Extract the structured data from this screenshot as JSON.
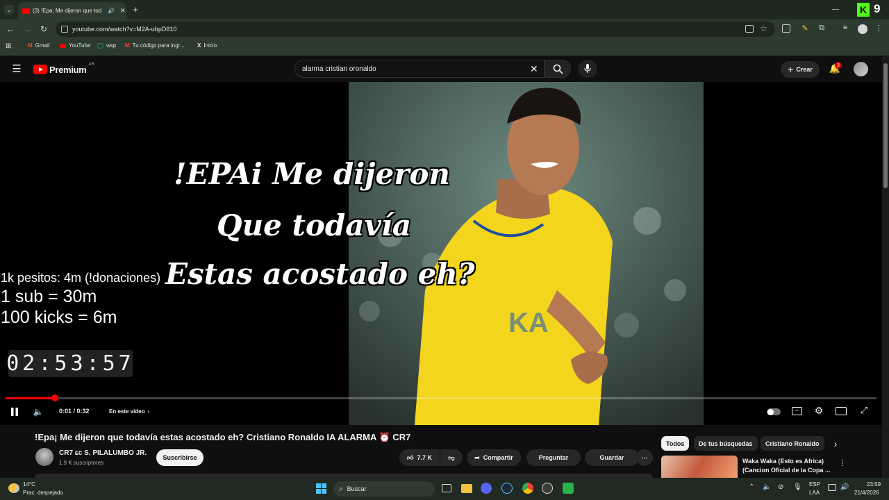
{
  "browser": {
    "tab_title": "(3) !Epa; Me dijeron que tod",
    "url": "youtube.com/watch?v=M2A-ubpD810",
    "bookmarks": [
      "Gmail",
      "YouTube",
      "wsp",
      "Tu código para ingr...",
      "Inicio"
    ],
    "ext_badge": "9"
  },
  "youtube": {
    "logo_text": "Premium",
    "logo_region": "AR",
    "search_value": "alarma cristian oronaldo",
    "create_label": "Crear",
    "notif_count": "3"
  },
  "video": {
    "overlay_lines": [
      "!EPAi Me dijeron",
      "Que todavía",
      "Estas acostado eh?"
    ],
    "side_text": [
      "1k pesitos: 4m (!donaciones)",
      "1 sub = 30m",
      "100 kicks = 6m"
    ],
    "timer": "02:53:57",
    "time": "0:01 / 0:32",
    "chapter_label": "En este video",
    "progress": 0.057,
    "jersey_text": "KA"
  },
  "meta": {
    "title": "!Epa¡ Me dijeron que todavía estas acostado eh? Cristiano Ronaldo IA ALARMA ⏰ CR7",
    "channel": "CR7 ᴇᴄ S. PILALUMBO JR.",
    "subscribers": "1.9 K suscriptores",
    "subscribe_label": "Suscribirse",
    "likes": "7.7 K",
    "share_label": "Compartir",
    "ask_label": "Preguntar",
    "save_label": "Guardar"
  },
  "chips": [
    "Todos",
    "De tus búsquedas",
    "Cristiano Ronaldo"
  ],
  "recommended": {
    "title_line1": "Waka Waka (Esto es Africa)",
    "title_line2": "(Cancion Oficial de la Copa ..."
  },
  "taskbar": {
    "temp": "14°C",
    "weather": "Prac. despejado",
    "search_label": "Buscar",
    "lang1": "ESP",
    "lang2": "LAA",
    "time": "23:59",
    "date": "21/4/2026"
  },
  "colors": {
    "accent_red": "#ff0000",
    "browser_green": "#2d3b2e",
    "jersey_yellow": "#f2d51c"
  }
}
